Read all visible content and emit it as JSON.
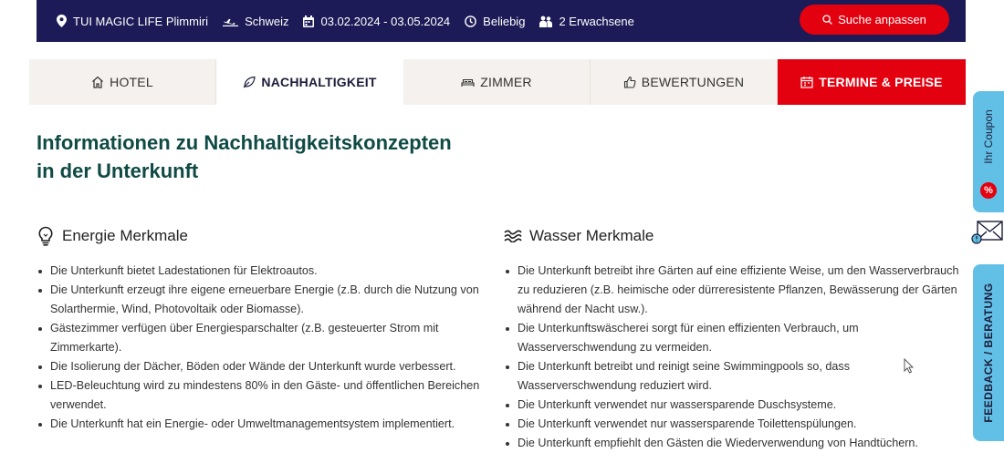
{
  "topbar": {
    "hotel": "TUI MAGIC LIFE Plimmiri",
    "departure": "Schweiz",
    "dates": "03.02.2024 - 03.05.2024",
    "duration": "Beliebig",
    "travellers": "2 Erwachsene",
    "search_button": "Suche anpassen"
  },
  "tabs": [
    {
      "label": "HOTEL",
      "icon": "house-icon"
    },
    {
      "label": "NACHHALTIGKEIT",
      "icon": "leaf-icon"
    },
    {
      "label": "ZIMMER",
      "icon": "bed-icon"
    },
    {
      "label": "BEWERTUNGEN",
      "icon": "thumbs-up-icon"
    },
    {
      "label": "TERMINE & PREISE",
      "icon": "calendar-icon"
    }
  ],
  "page_title_line1": "Informationen zu Nachhaltigkeitskonzepten",
  "page_title_line2": "in der Unterkunft",
  "energy": {
    "title": "Energie Merkmale",
    "items": [
      "Die Unterkunft bietet Ladestationen für Elektroautos.",
      "Die Unterkunft erzeugt ihre eigene erneuerbare Energie (z.B. durch die Nutzung von Solarthermie, Wind, Photovoltaik oder Biomasse).",
      "Gästezimmer verfügen über Energiesparschalter (z.B. gesteuerter Strom mit Zimmerkarte).",
      "Die Isolierung der Dächer, Böden oder Wände der Unterkunft wurde verbessert.",
      "LED-Beleuchtung wird zu mindestens 80% in den Gäste- und öffentlichen Bereichen verwendet.",
      "Die Unterkunft hat ein Energie- oder Umweltmanagementsystem implementiert."
    ]
  },
  "water": {
    "title": "Wasser Merkmale",
    "items": [
      "Die Unterkunft betreibt ihre Gärten auf eine effiziente Weise, um den Wasserverbrauch zu reduzieren (z.B. heimische oder dürreresistente Pflanzen, Bewässerung der Gärten während der Nacht usw.).",
      "Die Unterkunftswäscherei sorgt für einen effizienten Verbrauch, um Wasserverschwendung zu vermeiden.",
      "Die Unterkunft betreibt und reinigt seine Swimmingpools so, dass Wasserverschwendung reduziert wird.",
      "Die Unterkunft verwendet nur wassersparende Duschsysteme.",
      "Die Unterkunft verwendet nur wassersparende Toilettenspülungen.",
      "Die Unterkunft empfiehlt den Gästen die Wiederverwendung von Handtüchern."
    ]
  },
  "side": {
    "coupon": "Ihr Coupon",
    "coupon_badge": "%",
    "feedback": "FEEDBACK / BERATUNG"
  },
  "colors": {
    "navy": "#1d1b57",
    "red": "#e3000f",
    "title_green": "#0f4a45",
    "side_blue": "#62c0e6"
  }
}
